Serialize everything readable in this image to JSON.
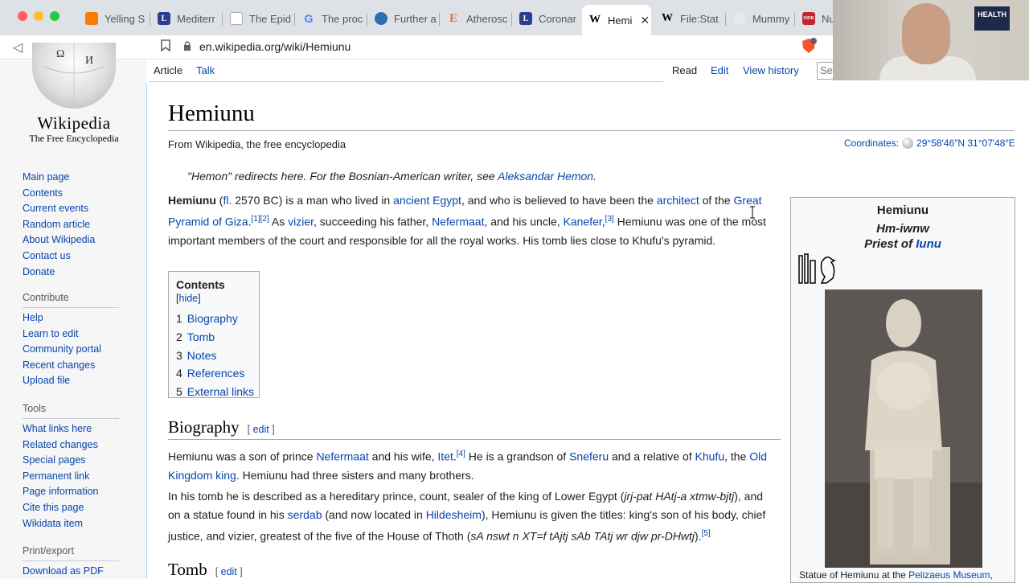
{
  "browser": {
    "tabs": [
      {
        "label": "Yelling S",
        "icon": "blogger-icon",
        "color": "#f57d00",
        "active": false
      },
      {
        "label": "Mediterr",
        "icon": "l-icon",
        "color": "#2c3e8f",
        "active": false
      },
      {
        "label": "The Epid",
        "icon": "blank-page-icon",
        "color": "#ffffff",
        "active": false
      },
      {
        "label": "The proc",
        "icon": "google-icon",
        "color": "#4285f4",
        "active": false
      },
      {
        "label": "Further a",
        "icon": "globe-icon",
        "color": "#2a6fb0",
        "active": false
      },
      {
        "label": "Atherosc",
        "icon": "e-icon",
        "color": "#e8732a",
        "active": false
      },
      {
        "label": "Coronar",
        "icon": "l-icon",
        "color": "#2c3e8f",
        "active": false
      },
      {
        "label": "Hemi",
        "icon": "wikipedia-icon",
        "color": "#ffffff",
        "active": true
      },
      {
        "label": "File:Stat",
        "icon": "wikipedia-icon",
        "color": "#ffffff",
        "active": false
      },
      {
        "label": "Mummy",
        "icon": "globe-icon",
        "color": "#e8e8e8",
        "active": false
      },
      {
        "label": "Nu",
        "icon": "odr-icon",
        "color": "#c1272d",
        "active": false
      }
    ],
    "url": "en.wikipedia.org/wiki/Hemiunu",
    "webcam_sign": "HEALTH"
  },
  "sidebar": {
    "logo": {
      "wordmark": "Wikipedia",
      "tagline": "The Free Encyclopedia"
    },
    "navigation": [
      "Main page",
      "Contents",
      "Current events",
      "Random article",
      "About Wikipedia",
      "Contact us",
      "Donate"
    ],
    "contribute": {
      "heading": "Contribute",
      "items": [
        "Help",
        "Learn to edit",
        "Community portal",
        "Recent changes",
        "Upload file"
      ]
    },
    "tools": {
      "heading": "Tools",
      "items": [
        "What links here",
        "Related changes",
        "Special pages",
        "Permanent link",
        "Page information",
        "Cite this page",
        "Wikidata item"
      ]
    },
    "print": {
      "heading": "Print/export",
      "items": [
        "Download as PDF"
      ]
    }
  },
  "article_tabs": {
    "article": "Article",
    "talk": "Talk",
    "read": "Read",
    "edit": "Edit",
    "history": "View history",
    "search_placeholder": "Se"
  },
  "article": {
    "title": "Hemiunu",
    "tagline": "From Wikipedia, the free encyclopedia",
    "coords_label": "Coordinates:",
    "coords_value": "29°58′46″N 31°07′48″E",
    "hatnote_pre": "\"Hemon\" redirects here. For the Bosnian-American writer, see ",
    "hatnote_link": "Aleksandar Hemon",
    "hatnote_post": ".",
    "lead": {
      "name": "Hemiunu",
      "p1": " (",
      "fl": "fl.",
      "p2": " 2570 BC) is a man who lived in ",
      "ancient_egypt": "ancient Egypt",
      "p3": ", and who is believed to have been the ",
      "architect": "architect",
      "p4": " of the ",
      "pyramid": "Great Pyramid of Giza",
      "p5": ".",
      "ref12": "[1][2]",
      "p6": " As ",
      "vizier": "vizier",
      "p7": ", succeeding his father, ",
      "nefermaat": "Nefermaat",
      "p8": ", and his uncle, ",
      "kanefer": "Kanefer",
      "p9": ",",
      "ref3": "[3]",
      "p10": " Hemiunu was one of the most important members of the court and responsible for all the royal works. His tomb lies close to Khufu's pyramid."
    },
    "toc": {
      "title": "Contents",
      "hide": "hide",
      "items": [
        {
          "num": "1",
          "label": "Biography"
        },
        {
          "num": "2",
          "label": "Tomb"
        },
        {
          "num": "3",
          "label": "Notes"
        },
        {
          "num": "4",
          "label": "References"
        },
        {
          "num": "5",
          "label": "External links"
        }
      ]
    },
    "biography": {
      "heading": "Biography",
      "edit": "edit",
      "p1": {
        "a": "Hemiunu was a son of prince ",
        "nefermaat": "Nefermaat",
        "b": " and his wife, ",
        "itet": "Itet",
        "c": ".",
        "ref4": "[4]",
        "d": " He is a grandson of ",
        "sneferu": "Sneferu",
        "e": " and a relative of ",
        "khufu": "Khufu",
        "f": ", the ",
        "old_kingdom": "Old Kingdom king",
        "g": ". Hemiunu had three sisters and many brothers."
      },
      "p2": {
        "a": "In his tomb he is described as a hereditary prince, count, sealer of the king of Lower Egypt (",
        "translit1": "jrj-pat HAtj-a xtmw-bjtj",
        "b": "), and on a statue found in his ",
        "serdab": "serdab",
        "c": " (and now located in ",
        "hildesheim": "Hildesheim",
        "d": "), Hemiunu is given the titles: king's son of his body, chief justice, and vizier, greatest of the five of the House of Thoth (",
        "translit2": "sA nswt n XT=f tAjtj sAb TAtj wr djw pr-DHwtj",
        "e": ").",
        "ref5": "[5]"
      }
    },
    "tomb": {
      "heading": "Tomb",
      "edit": "edit"
    }
  },
  "infobox": {
    "title": "Hemiunu",
    "name": "Hm-iwnw",
    "role_pre": "Priest of ",
    "role_link": "Iunu",
    "caption_pre": "Statue of Hemiunu at the ",
    "caption_link": "Pelizaeus Museum",
    "caption_post": ","
  },
  "colors": {
    "link": "#0645ad",
    "chrome": "#dee1e6",
    "sidebar": "#f6f6f6"
  }
}
